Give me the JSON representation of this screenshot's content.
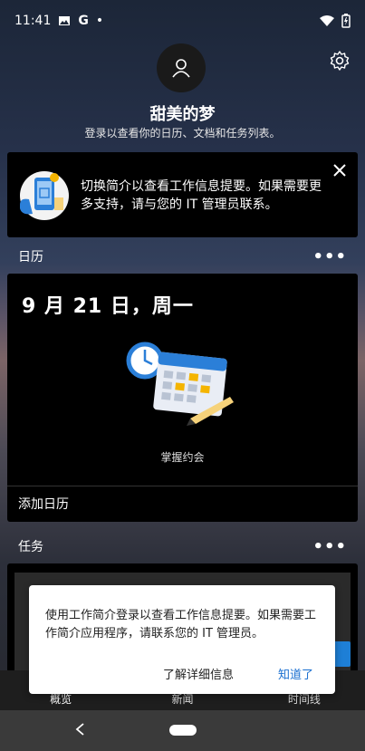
{
  "status_bar": {
    "time": "11:41",
    "google_letter": "G",
    "dot": "•"
  },
  "profile": {
    "name": "甜美的梦",
    "subtitle": "登录以查看你的日历、文档和任务列表。"
  },
  "banner": {
    "text": "切换简介以查看工作信息提要。如果需要更多支持，请与您的 IT 管理员联系。"
  },
  "calendar": {
    "section_title": "日历",
    "more": "•••",
    "date": "9 月 21 日，周一",
    "caption": "掌握约会",
    "add_label": "添加日历"
  },
  "tasks": {
    "section_title": "任务",
    "more": "•••"
  },
  "bottom_nav": {
    "items": [
      "概览",
      "新闻",
      "时间线"
    ]
  },
  "toast": {
    "text": "使用工作简介登录以查看工作信息提要。如果需要工作简介应用程序，请联系您的 IT 管理员。",
    "learn_more": "了解详细信息",
    "ok": "知道了"
  },
  "colors": {
    "accent": "#1a6fd0",
    "card_bg": "#000000",
    "nav_bg": "#1e1e1e"
  },
  "icons": {
    "image": "image-icon",
    "wifi": "wifi-icon",
    "battery": "battery-icon",
    "user": "user-icon",
    "gear": "gear-icon",
    "close": "close-icon",
    "back": "back-triangle-icon",
    "home": "home-pill-icon"
  }
}
